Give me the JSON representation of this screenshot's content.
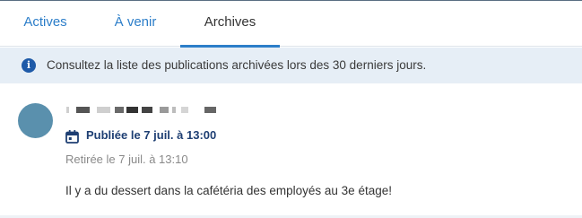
{
  "tabs": [
    {
      "label": "Actives",
      "active": false
    },
    {
      "label": "À venir",
      "active": false
    },
    {
      "label": "Archives",
      "active": true
    }
  ],
  "banner": {
    "icon": "info-icon",
    "text": "Consultez la liste des publications archivées lors des 30 derniers jours."
  },
  "post": {
    "avatar": "avatar",
    "author_redacted": true,
    "published": "Publiée le 7 juil. à 13:00",
    "published_icon": "calendar-icon",
    "retired": "Retirée le 7 juil. à 13:10",
    "message": "Il y a du dessert dans la cafétéria des employés au 3e étage!"
  },
  "colors": {
    "accent": "#2c7ec9",
    "banner_bg": "#e6eef6",
    "published_text": "#1e3f73",
    "avatar": "#5a90ad"
  }
}
